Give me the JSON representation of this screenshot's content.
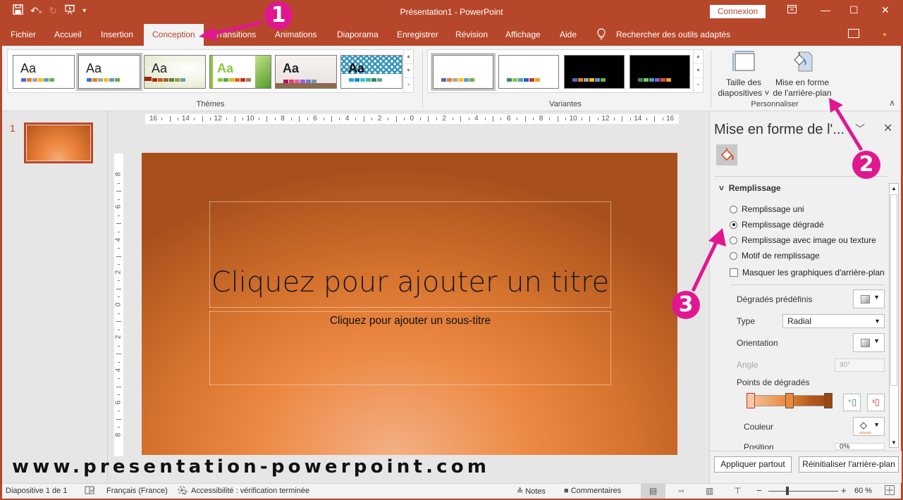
{
  "app": {
    "title": "Présentation1  -  PowerPoint",
    "signin_label": "Connexion",
    "brand_color": "#b7472a",
    "annotation_color": "#e0178e"
  },
  "qat": {
    "save_icon": "save-icon",
    "undo_icon": "undo-icon",
    "redo_icon": "redo-icon",
    "present_icon": "present-from-start-icon",
    "customize_icon": "customize-qat-icon"
  },
  "window_controls": {
    "ribbon_display": "ribbon-display-options-icon",
    "minimize": "minimize-icon",
    "maximize": "maximize-icon",
    "close": "close-icon"
  },
  "tabs": [
    {
      "label": "Fichier"
    },
    {
      "label": "Accueil"
    },
    {
      "label": "Insertion"
    },
    {
      "label": "Conception",
      "active": true
    },
    {
      "label": "Transitions"
    },
    {
      "label": "Animations"
    },
    {
      "label": "Diaporama"
    },
    {
      "label": "Enregistrer"
    },
    {
      "label": "Révision"
    },
    {
      "label": "Affichage"
    },
    {
      "label": "Aide"
    }
  ],
  "tell_me": "Rechercher des outils adaptés",
  "ribbon": {
    "themes_label": "Thèmes",
    "variants_label": "Variantes",
    "customize_label": "Personnaliser",
    "themes": [
      {
        "sample": "Aa",
        "selected": false,
        "colors": [
          "#4472c4",
          "#ed7d31",
          "#a5a5a5",
          "#ffc000",
          "#5b9bd5",
          "#70ad47"
        ]
      },
      {
        "sample": "Aa",
        "selected": true,
        "colors": [
          "#4472c4",
          "#ed7d31",
          "#a5a5a5",
          "#ffc000",
          "#5b9bd5",
          "#70ad47"
        ]
      },
      {
        "sample": "Aa",
        "selected": false,
        "colors": [
          "#a5300f",
          "#d55816",
          "#8c6c39",
          "#6b7c3c",
          "#8da34b",
          "#6a9e95"
        ]
      },
      {
        "sample": "Aa",
        "selected": false,
        "colors": [
          "#8cc63f",
          "#4caf50",
          "#e6b91e",
          "#e76618",
          "#c42f1a",
          "#918655"
        ]
      },
      {
        "sample": "Aa",
        "selected": false,
        "colors": [
          "#b31166",
          "#e33d6f",
          "#e45f9e",
          "#a05ce2",
          "#6c7ed9",
          "#6c9ab0"
        ]
      },
      {
        "sample": "Aa",
        "selected": false,
        "colors": [
          "#1cade4",
          "#2683c6",
          "#27ced7",
          "#42ba97",
          "#3e8853",
          "#62a39f"
        ]
      }
    ],
    "variants": [
      {
        "background": "#ffffff",
        "selected": true,
        "colors": [
          "#4472c4",
          "#ed7d31",
          "#a5a5a5",
          "#ffc000",
          "#5b9bd5",
          "#70ad47"
        ]
      },
      {
        "background": "#ffffff",
        "selected": false,
        "colors": [
          "#2e8b78",
          "#8cc63f",
          "#3aa3d4",
          "#2563b0",
          "#c0392b",
          "#f0a030"
        ]
      },
      {
        "background": "#000000",
        "selected": false,
        "colors": [
          "#4472c4",
          "#ed7d31",
          "#a5a5a5",
          "#ffc000",
          "#5b9bd5",
          "#70ad47"
        ]
      },
      {
        "background": "#000000",
        "selected": false,
        "colors": [
          "#2e8b78",
          "#8cc63f",
          "#3aa3d4",
          "#8e5ec8",
          "#d9502f",
          "#f0a030"
        ]
      }
    ],
    "slide_size": {
      "line1": "Taille des",
      "line2": "diapositives ˅"
    },
    "format_background": {
      "line1": "Mise en forme",
      "line2": "de l'arrière-plan"
    }
  },
  "slides_pane": {
    "slide_number": "1"
  },
  "rulers": {
    "horizontal": [
      "16",
      "14",
      "12",
      "10",
      "8",
      "6",
      "4",
      "2",
      "0",
      "2",
      "4",
      "6",
      "8",
      "10",
      "12",
      "14",
      "16"
    ],
    "vertical": [
      "8",
      "6",
      "4",
      "2",
      "0",
      "2",
      "4",
      "6",
      "8"
    ]
  },
  "slide": {
    "title_placeholder": "Cliquez pour ajouter un titre",
    "subtitle_placeholder": "Cliquez pour ajouter un sous-titre"
  },
  "watermark": "www.presentation-powerpoint.com",
  "format_pane": {
    "title": "Mise en forme de l'...",
    "section": "Remplissage",
    "options": [
      {
        "label": "Remplissage uni",
        "checked": false
      },
      {
        "label": "Remplissage dégradé",
        "checked": true
      },
      {
        "label": "Remplissage avec image ou texture",
        "checked": false
      },
      {
        "label": "Motif de remplissage",
        "checked": false
      }
    ],
    "hide_graphics_label": "Masquer les graphiques d'arrière-plan",
    "hide_graphics_checked": false,
    "preset_label": "Dégradés prédéfinis",
    "type_label": "Type",
    "type_value": "Radial",
    "orientation_label": "Orientation",
    "angle_label": "Angle",
    "angle_value": "90°",
    "stops_label": "Points de dégradés",
    "gradient_stops": [
      {
        "position_pct": 0,
        "color": "#f7c9a8"
      },
      {
        "position_pct": 50,
        "color": "#eb8a3c"
      },
      {
        "position_pct": 100,
        "color": "#9c4710"
      }
    ],
    "color_label": "Couleur",
    "position_label": "Position",
    "position_value": "0%",
    "apply_all_label": "Appliquer partout",
    "reset_label": "Réinitialiser l'arrière-plan"
  },
  "statusbar": {
    "slide_info": "Diapositive 1 de 1",
    "language": "Français (France)",
    "accessibility": "Accessibilité : vérification terminée",
    "notes_label": "Notes",
    "comments_label": "Commentaires",
    "zoom_minus": "−",
    "zoom_plus": "+",
    "zoom_value": "60 %"
  },
  "annotations": [
    "1",
    "2",
    "3"
  ]
}
